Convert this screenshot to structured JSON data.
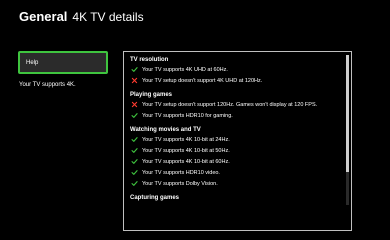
{
  "header": {
    "section": "General",
    "page_title": "4K TV details"
  },
  "sidebar": {
    "help_label": "Help",
    "support_note": "Your TV supports 4K."
  },
  "details": {
    "groups": [
      {
        "title": "TV resolution",
        "items": [
          {
            "status": "ok",
            "text": "Your TV supports 4K UHD at 60Hz."
          },
          {
            "status": "not-ok",
            "text": "Your TV setup doesn't support 4K UHD at 120Hz."
          }
        ]
      },
      {
        "title": "Playing games",
        "items": [
          {
            "status": "not-ok",
            "text": "Your TV setup doesn't support 120Hz. Games won't display at 120 FPS."
          },
          {
            "status": "ok",
            "text": "Your TV supports HDR10 for gaming."
          }
        ]
      },
      {
        "title": "Watching movies and TV",
        "items": [
          {
            "status": "ok",
            "text": "Your TV supports 4K 10-bit at 24Hz."
          },
          {
            "status": "ok",
            "text": "Your TV supports 4K 10-bit at 50Hz."
          },
          {
            "status": "ok",
            "text": "Your TV supports 4K 10-bit at 60Hz."
          },
          {
            "status": "ok",
            "text": "Your TV supports HDR10 video."
          },
          {
            "status": "ok",
            "text": "Your TV supports Dolby Vision."
          }
        ]
      },
      {
        "title": "Capturing games",
        "items": []
      }
    ],
    "scroll_position": 0.0,
    "scroll_visible_fraction": 0.78
  },
  "colors": {
    "accent": "#3fc43f",
    "not_supported": "#ff3b30",
    "background": "#000000",
    "panel_border": "#bfbfbf"
  },
  "icons": {
    "ok": "check-icon",
    "not-ok": "x-mark-icon"
  }
}
